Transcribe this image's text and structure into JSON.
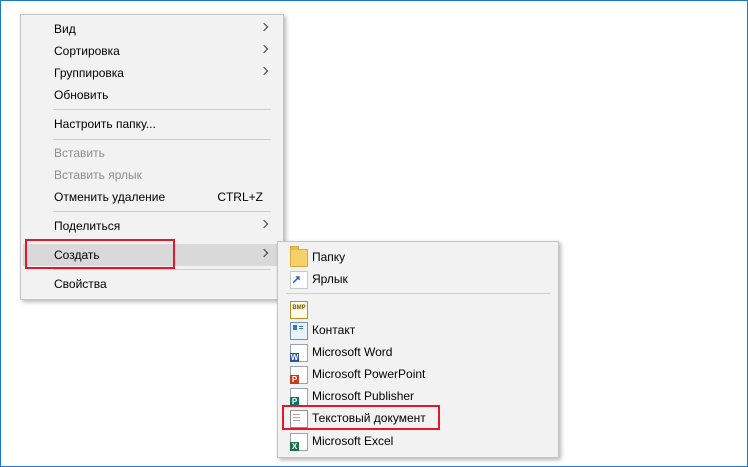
{
  "main_menu": {
    "items": [
      {
        "label": "Вид",
        "submenu": true
      },
      {
        "label": "Сортировка",
        "submenu": true
      },
      {
        "label": "Группировка",
        "submenu": true
      },
      {
        "label": "Обновить"
      },
      {
        "label": "Настроить папку..."
      },
      {
        "label": "Вставить",
        "disabled": true
      },
      {
        "label": "Вставить ярлык",
        "disabled": true
      },
      {
        "label": "Отменить удаление",
        "shortcut": "CTRL+Z"
      },
      {
        "label": "Поделиться",
        "submenu": true
      },
      {
        "label": "Создать",
        "submenu": true,
        "highlighted": true
      },
      {
        "label": "Свойства"
      }
    ]
  },
  "sub_menu": {
    "items": [
      {
        "label": "Папку",
        "icon": "folder-icon"
      },
      {
        "label": "Ярлык",
        "icon": "shortcut-icon"
      },
      {
        "label": "",
        "icon": "bitmap-icon"
      },
      {
        "label": "Контакт",
        "icon": "contact-icon"
      },
      {
        "label": "Microsoft Word",
        "icon": "word-icon"
      },
      {
        "label": "Microsoft PowerPoint",
        "icon": "powerpoint-icon"
      },
      {
        "label": "Microsoft Publisher",
        "icon": "publisher-icon"
      },
      {
        "label": "Текстовый документ",
        "icon": "text-document-icon",
        "highlighted": true
      },
      {
        "label": "Microsoft Excel",
        "icon": "excel-icon"
      }
    ]
  },
  "colors": {
    "menu_background": "#f2f2f2",
    "hover_background": "#d9d9d9",
    "highlight_box": "#e3192b",
    "disabled_text": "#8d8d8d",
    "frame_border": "#1e78c8"
  }
}
